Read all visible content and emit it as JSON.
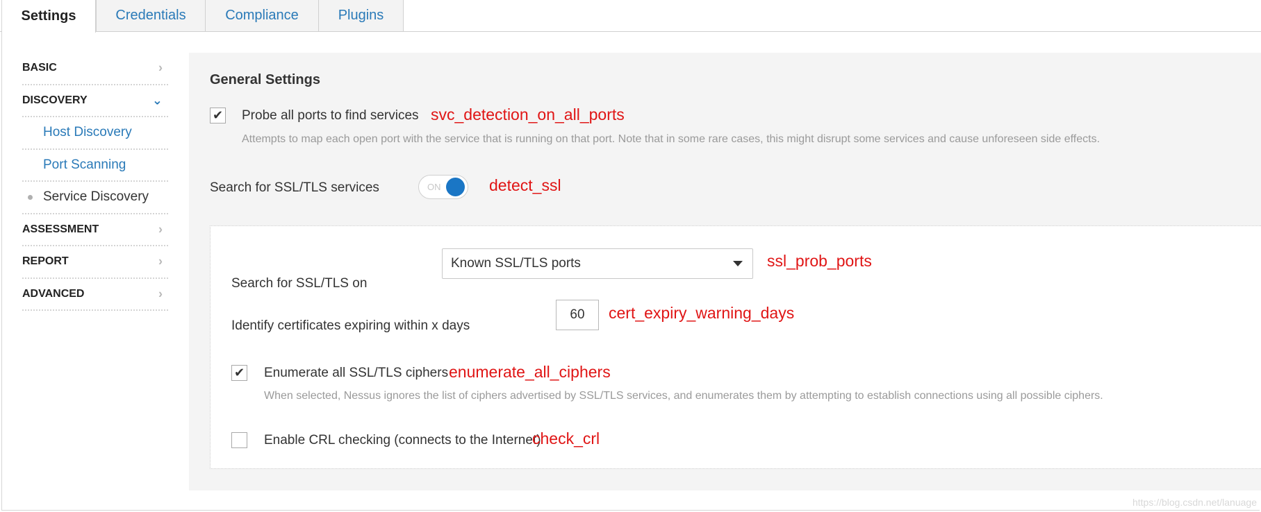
{
  "tabs": [
    {
      "label": "Settings"
    },
    {
      "label": "Credentials"
    },
    {
      "label": "Compliance"
    },
    {
      "label": "Plugins"
    }
  ],
  "sidebar": {
    "items": [
      {
        "label": "BASIC"
      },
      {
        "label": "DISCOVERY"
      },
      {
        "label": "Host Discovery"
      },
      {
        "label": "Port Scanning"
      },
      {
        "label": "Service Discovery"
      },
      {
        "label": "ASSESSMENT"
      },
      {
        "label": "REPORT"
      },
      {
        "label": "ADVANCED"
      }
    ]
  },
  "general": {
    "title": "General Settings",
    "probe_all_ports": {
      "label": "Probe all ports to find services",
      "annotation": "svc_detection_on_all_ports",
      "description": "Attempts to map each open port with the service that is running on that port. Note that in some rare cases, this might disrupt some services and cause unforeseen side effects.",
      "checked": true
    },
    "search_ssl": {
      "label": "Search for SSL/TLS services",
      "toggle_text": "ON",
      "annotation": "detect_ssl",
      "on": true
    }
  },
  "ssl": {
    "search_on": {
      "label": "Search for SSL/TLS on",
      "value": "Known SSL/TLS ports",
      "annotation": "ssl_prob_ports"
    },
    "cert_expiry": {
      "label": "Identify certificates expiring within x days",
      "value": "60",
      "annotation": "cert_expiry_warning_days"
    },
    "enumerate_ciphers": {
      "label": "Enumerate all SSL/TLS ciphers",
      "annotation": "enumerate_all_ciphers",
      "description": "When selected, Nessus ignores the list of ciphers advertised by SSL/TLS services, and enumerates them by attempting to establish connections using all possible ciphers.",
      "checked": true
    },
    "crl_check": {
      "label": "Enable CRL checking (connects to the Internet)",
      "annotation": "check_crl",
      "checked": false
    }
  },
  "colors": {
    "link": "#2a7ab8",
    "annotation": "#e01515",
    "toggle_on": "#1a76c5"
  },
  "watermark": "https://blog.csdn.net/lanuage"
}
